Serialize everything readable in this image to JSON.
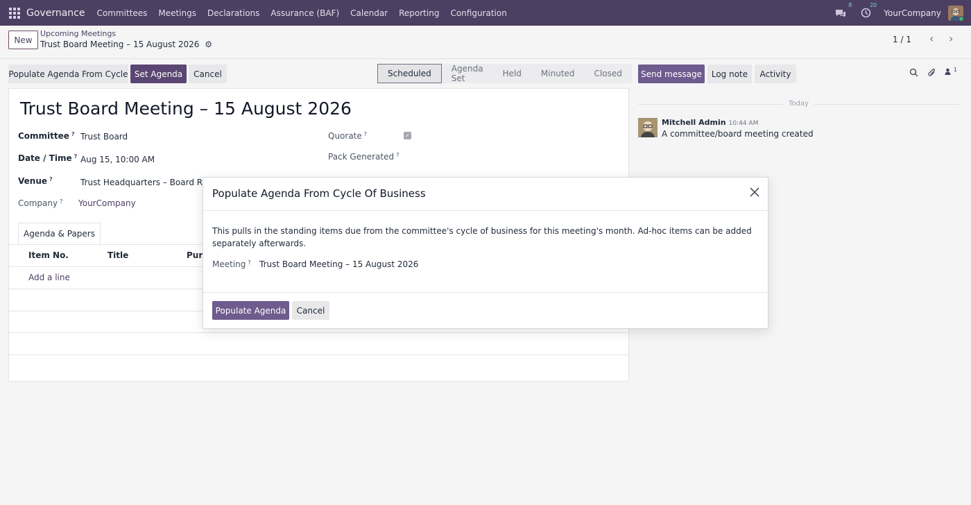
{
  "navbar": {
    "brand": "Governance",
    "items": [
      "Committees",
      "Meetings",
      "Declarations",
      "Assurance (BAF)",
      "Calendar",
      "Reporting",
      "Configuration"
    ],
    "messages_badge": "8",
    "activities_badge": "20",
    "company": "YourCompany"
  },
  "control_panel": {
    "new_label": "New",
    "breadcrumb_parent": "Upcoming Meetings",
    "breadcrumb_current": "Trust Board Meeting – 15 August 2026",
    "pager": "1 / 1"
  },
  "actions": {
    "populate": "Populate Agenda From Cycle",
    "set_agenda": "Set Agenda",
    "cancel": "Cancel"
  },
  "status_stages": [
    "Scheduled",
    "Agenda Set",
    "Held",
    "Minuted",
    "Closed"
  ],
  "active_stage": "Scheduled",
  "chatter": {
    "send_message": "Send message",
    "log_note": "Log note",
    "activity": "Activity",
    "followers_count": "1",
    "today": "Today",
    "message": {
      "author": "Mitchell Admin",
      "time": "10:44 AM",
      "body": "A committee/board meeting created"
    }
  },
  "form": {
    "title": "Trust Board Meeting – 15 August 2026",
    "committee_label": "Committee",
    "committee_value": "Trust Board",
    "datetime_label": "Date / Time",
    "datetime_value": "Aug 15, 10:00 AM",
    "venue_label": "Venue",
    "venue_value": "Trust Headquarters – Board Room",
    "company_label": "Company",
    "company_value": "YourCompany",
    "quorate_label": "Quorate",
    "quorate_checked": true,
    "pack_label": "Pack Generated",
    "tab_label": "Agenda & Papers",
    "columns": [
      "Item No.",
      "Title",
      "Purp"
    ],
    "add_line": "Add a line"
  },
  "modal": {
    "title": "Populate Agenda From Cycle Of Business",
    "body": "This pulls in the standing items due from the committee's cycle of business for this meeting's month. Ad-hoc items can be added separately afterwards.",
    "field_label": "Meeting",
    "field_value": "Trust Board Meeting – 15 August 2026",
    "confirm": "Populate Agenda",
    "cancel": "Cancel"
  }
}
